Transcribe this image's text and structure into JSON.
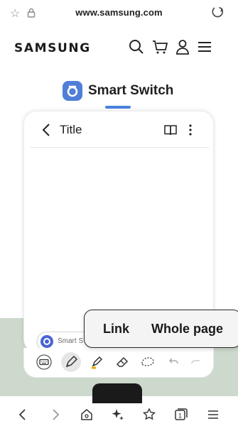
{
  "browser": {
    "url": "www.samsung.com",
    "icons": [
      "star-icon",
      "lock-icon",
      "reload-icon"
    ]
  },
  "site": {
    "logo": "SAMSUNG",
    "icons": [
      "search-icon",
      "cart-icon",
      "account-icon",
      "menu-icon"
    ]
  },
  "page": {
    "app_title": "Smart Switch"
  },
  "note": {
    "title": "Title",
    "icons": [
      "back-icon",
      "book-icon",
      "more-options-icon"
    ],
    "chip_label": "Smart S"
  },
  "toolbar": {
    "tools": [
      "keyboard-icon",
      "pen-icon",
      "highlighter-icon",
      "eraser-icon",
      "lasso-icon",
      "undo-icon",
      "redo-icon"
    ],
    "selected": "pen-icon"
  },
  "capture": {
    "option_link": "Link",
    "option_whole_page": "Whole page"
  },
  "nav": {
    "icons": [
      "back-icon",
      "forward-icon",
      "home-icon",
      "sparkle-icon",
      "bookmarks-icon",
      "tabs-icon",
      "menu-icon"
    ],
    "tab_count": "1"
  },
  "colors": {
    "accent": "#4a7fe0",
    "smart_switch_badge": "#4f7fd6",
    "background_band": "#ccd9cc"
  }
}
